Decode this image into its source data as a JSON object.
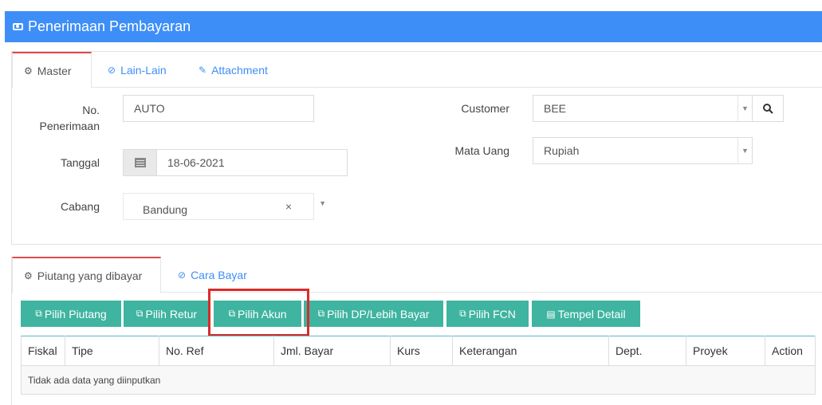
{
  "window": {
    "title": "Penerimaan Pembayaran",
    "title_icon": "money-icon",
    "accent_color": "#3e8ef7"
  },
  "tabs": [
    {
      "label": "Master",
      "icon": "gears-icon",
      "active": true
    },
    {
      "label": "Lain-Lain",
      "icon": "check-circle-icon",
      "active": false
    },
    {
      "label": "Attachment",
      "icon": "paperclip-icon",
      "active": false
    }
  ],
  "form": {
    "no_penerimaan_label_1": "No.",
    "no_penerimaan_label_2": "Penerimaan",
    "no_penerimaan_value": "AUTO",
    "tanggal_label": "Tanggal",
    "tanggal_value": "18-06-2021",
    "cabang_label": "Cabang",
    "cabang_value": "Bandung",
    "customer_label": "Customer",
    "customer_value": "BEE",
    "mata_uang_label": "Mata Uang",
    "mata_uang_value": "Rupiah"
  },
  "detail_tabs": [
    {
      "label": "Piutang yang dibayar",
      "icon": "gears-icon",
      "active": true
    },
    {
      "label": "Cara Bayar",
      "icon": "check-circle-icon",
      "active": false
    }
  ],
  "toolbar": {
    "button_color": "#3fb4a0",
    "pilih_piutang": "Pilih Piutang",
    "pilih_retur": "Pilih Retur",
    "pilih_akun": "Pilih Akun",
    "pilih_dp": "Pilih DP/Lebih Bayar",
    "pilih_fcn": "Pilih FCN",
    "tempel_detail": "Tempel Detail"
  },
  "table": {
    "headers": [
      "Fiskal",
      "Tipe",
      "No. Ref",
      "Jml. Bayar",
      "Kurs",
      "Keterangan",
      "Dept.",
      "Proyek",
      "Action"
    ],
    "empty_text": "Tidak ada data yang diinputkan"
  },
  "highlight_color": "#d92b2b"
}
